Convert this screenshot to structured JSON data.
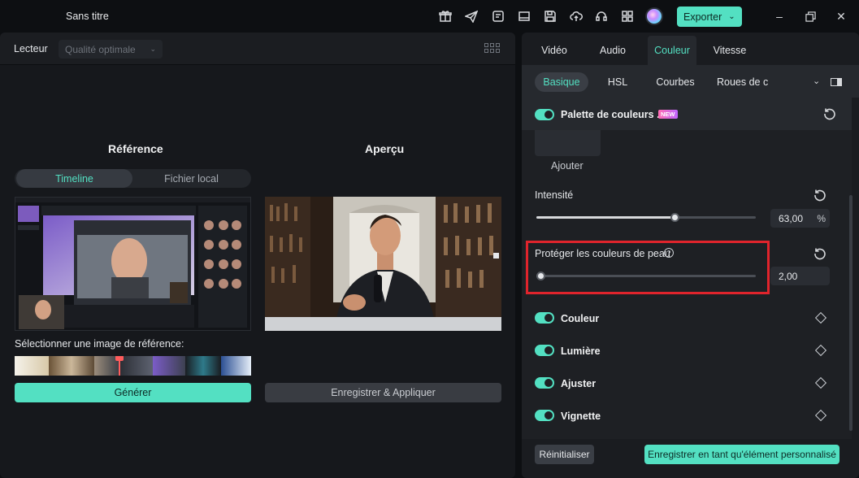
{
  "titlebar": {
    "app_title": "Sans titre",
    "export_label": "Exporter",
    "icons": [
      "gift-icon",
      "send-icon",
      "checklist-icon",
      "screen-icon",
      "save-icon",
      "cloud-upload-icon",
      "headset-icon",
      "apps-grid-icon"
    ]
  },
  "player": {
    "label": "Lecteur",
    "quality": "Qualité optimale",
    "reference_title": "Référence",
    "preview_title": "Aperçu",
    "tabs": [
      "Timeline",
      "Fichier local"
    ],
    "select_reference_label": "Sélectionner une image de référence:",
    "generate_label": "Générer",
    "save_apply_label": "Enregistrer & Appliquer"
  },
  "panel": {
    "main_tabs": [
      "Vidéo",
      "Audio",
      "Couleur",
      "Vitesse"
    ],
    "active_main_tab": "Couleur",
    "sub_tabs": [
      "Basique",
      "HSL",
      "Courbes",
      "Roues de c"
    ],
    "active_sub_tab": "Basique",
    "palette_label": "Palette de couleurs ...",
    "new_badge": "NEW",
    "add_label": "Ajouter",
    "intensity_label": "Intensité",
    "intensity_value": "63,00",
    "intensity_unit": "%",
    "intensity_fraction": 0.63,
    "skin_label": "Protéger les couleurs de peau",
    "skin_value": "2,00",
    "skin_fraction": 0.02,
    "sections": [
      "Couleur",
      "Lumière",
      "Ajuster",
      "Vignette"
    ],
    "reset_all_label": "Réinitialiser",
    "save_custom_label": "Enregistrer en tant qu'élément personnalisé"
  },
  "colors": {
    "accent": "#53e0c2",
    "highlight": "#e0242c"
  }
}
